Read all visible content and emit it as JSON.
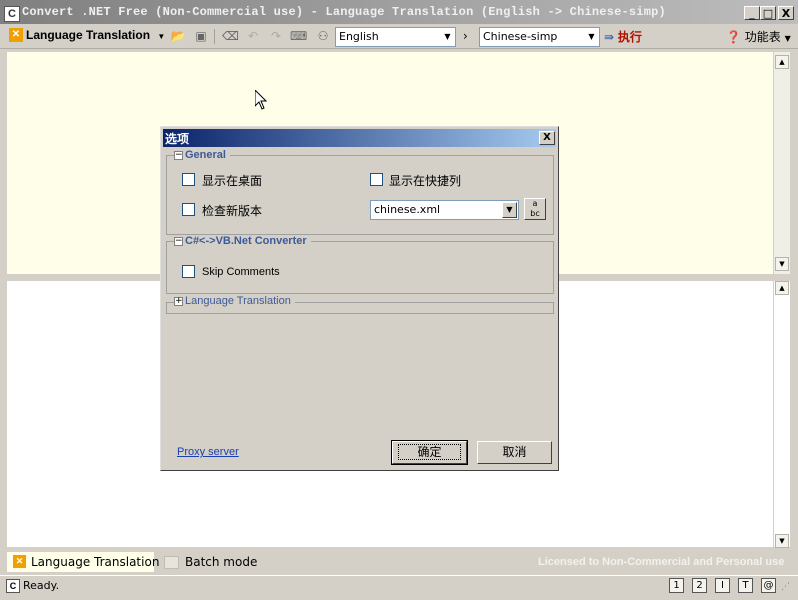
{
  "window": {
    "title": "Convert .NET Free (Non-Commercial use) - Language Translation (English -> Chinese-simp)",
    "icon": "C",
    "minimize": "_",
    "maximize": "□",
    "close": "X"
  },
  "toolbar": {
    "mode_label": "Language Translation",
    "source_lang": "English",
    "arrow": "›",
    "target_lang": "Chinese-simp",
    "execute_label": "执行",
    "menu_label": "功能表"
  },
  "dialog": {
    "title": "选项",
    "close": "X",
    "general": {
      "title": "General",
      "show_desktop": "显示在桌面",
      "show_quicklaunch": "显示在快捷列",
      "check_updates": "检查新版本",
      "language_file": "chinese.xml"
    },
    "converter": {
      "title": "C#<->VB.Net Converter",
      "skip_comments": "Skip Comments"
    },
    "translation": {
      "title": "Language Translation"
    },
    "proxy_link": "Proxy server",
    "ok_label": "确定",
    "cancel_label": "取消"
  },
  "tabs": {
    "language_translation": "Language Translation",
    "batch_mode": "Batch mode",
    "license_text": "Licensed to Non-Commercial and Personal use"
  },
  "status": {
    "text": "Ready.",
    "icons": [
      "1",
      "2",
      "I",
      "T",
      "@"
    ]
  },
  "colors": {
    "accent_orange": "#f0a000",
    "execute_red": "#b01000",
    "pane_yellow": "#fffee8"
  }
}
